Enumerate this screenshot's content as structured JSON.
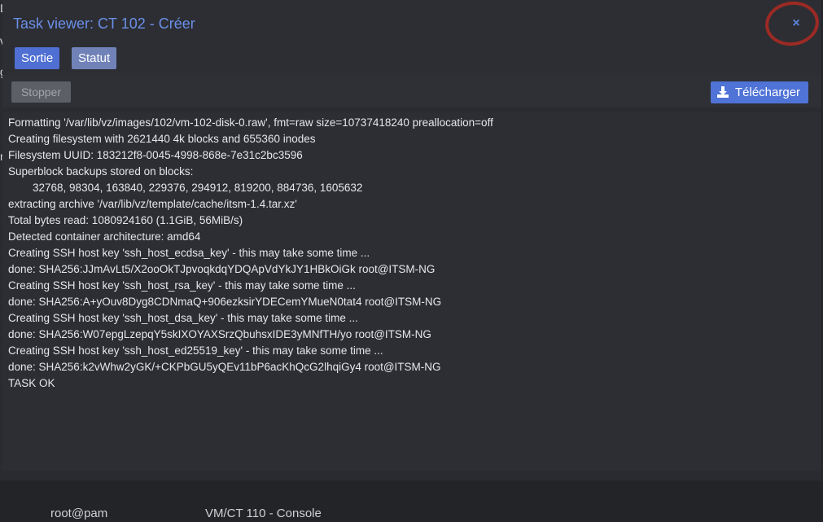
{
  "background": {
    "left_fragments": [
      "Di",
      "v",
      "g",
      "m"
    ],
    "bottom_row": {
      "user": "root@pam",
      "task": "VM/CT 110 - Console"
    }
  },
  "window": {
    "title": "Task viewer: CT 102 - Créer",
    "close_glyph": "×"
  },
  "tabs": [
    {
      "label": "Sortie"
    },
    {
      "label": "Statut"
    }
  ],
  "toolbar": {
    "stop_label": "Stopper",
    "download_label": "Télécharger"
  },
  "log_lines": [
    "Formatting '/var/lib/vz/images/102/vm-102-disk-0.raw', fmt=raw size=10737418240 preallocation=off",
    "Creating filesystem with 2621440 4k blocks and 655360 inodes",
    "Filesystem UUID: 183212f8-0045-4998-868e-7e31c2bc3596",
    "Superblock backups stored on blocks:",
    "        32768, 98304, 163840, 229376, 294912, 819200, 884736, 1605632",
    "extracting archive '/var/lib/vz/template/cache/itsm-1.4.tar.xz'",
    "Total bytes read: 1080924160 (1.1GiB, 56MiB/s)",
    "Detected container architecture: amd64",
    "Creating SSH host key 'ssh_host_ecdsa_key' - this may take some time ...",
    "done: SHA256:JJmAvLt5/X2ooOkTJpvoqkdqYDQApVdYkJY1HBkOiGk root@ITSM-NG",
    "Creating SSH host key 'ssh_host_rsa_key' - this may take some time ...",
    "done: SHA256:A+yOuv8Dyg8CDNmaQ+906ezksirYDECemYMueN0tat4 root@ITSM-NG",
    "Creating SSH host key 'ssh_host_dsa_key' - this may take some time ...",
    "done: SHA256:W07epgLzepqY5skIXOYAXSrzQbuhsxIDE3yMNfTH/yo root@ITSM-NG",
    "Creating SSH host key 'ssh_host_ed25519_key' - this may take some time ...",
    "done: SHA256:k2vWhw2yGK/+CKPbGU5yQEv11bP6acKhQcG2lhqiGy4 root@ITSM-NG",
    "TASK OK"
  ],
  "colors": {
    "accent": "#4f6fd3",
    "title": "#6a8fe8",
    "annotation": "#9c2a24"
  }
}
